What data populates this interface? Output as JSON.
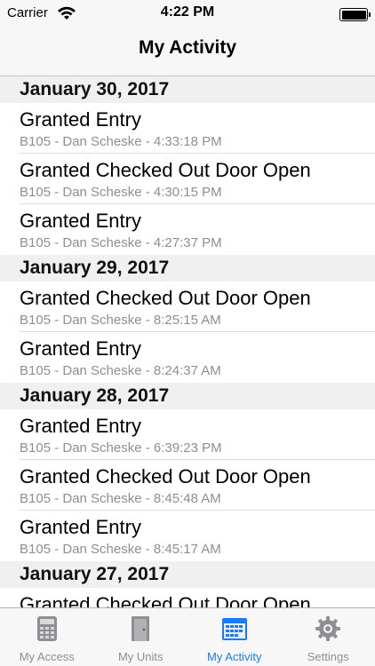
{
  "status_bar": {
    "carrier": "Carrier",
    "time": "4:22 PM"
  },
  "nav": {
    "title": "My Activity"
  },
  "sections": [
    {
      "date": "January 30, 2017",
      "items": [
        {
          "title": "Granted Entry",
          "subtitle": "B105 - Dan Scheske - 4:33:18 PM"
        },
        {
          "title": "Granted Checked Out Door Open",
          "subtitle": "B105 - Dan Scheske - 4:30:15 PM"
        },
        {
          "title": "Granted Entry",
          "subtitle": "B105 - Dan Scheske - 4:27:37 PM"
        }
      ]
    },
    {
      "date": "January 29, 2017",
      "items": [
        {
          "title": "Granted Checked Out Door Open",
          "subtitle": "B105 - Dan Scheske - 8:25:15 AM"
        },
        {
          "title": "Granted Entry",
          "subtitle": "B105 - Dan Scheske - 8:24:37 AM"
        }
      ]
    },
    {
      "date": "January 28, 2017",
      "items": [
        {
          "title": "Granted Entry",
          "subtitle": "B105 - Dan Scheske - 6:39:23 PM"
        },
        {
          "title": "Granted Checked Out Door Open",
          "subtitle": "B105 - Dan Scheske - 8:45:48 AM"
        },
        {
          "title": "Granted Entry",
          "subtitle": "B105 - Dan Scheske - 8:45:17 AM"
        }
      ]
    },
    {
      "date": "January 27, 2017",
      "items": [
        {
          "title": "Granted Checked Out Door Open",
          "subtitle": ""
        }
      ]
    }
  ],
  "tabs": [
    {
      "label": "My Access",
      "icon": "calculator-icon",
      "active": false
    },
    {
      "label": "My Units",
      "icon": "door-icon",
      "active": false
    },
    {
      "label": "My Activity",
      "icon": "calendar-icon",
      "active": true
    },
    {
      "label": "Settings",
      "icon": "gear-icon",
      "active": false
    }
  ],
  "colors": {
    "accent": "#1a7cf5",
    "inactive": "#8e8e93",
    "section_bg": "#f0f0f0"
  }
}
